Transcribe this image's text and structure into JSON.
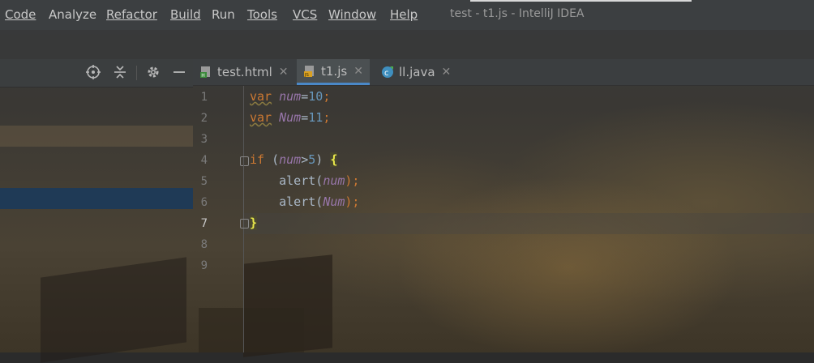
{
  "menu": {
    "items": [
      {
        "label": "Code",
        "mnemonic_index": 0
      },
      {
        "label": "Analyze",
        "mnemonic_index": -1
      },
      {
        "label": "Refactor",
        "mnemonic_index": 0
      },
      {
        "label": "Build",
        "mnemonic_index": 0
      },
      {
        "label": "Run",
        "mnemonic_index": 1
      },
      {
        "label": "Tools",
        "mnemonic_index": 0
      },
      {
        "label": "VCS",
        "mnemonic_index": 0
      },
      {
        "label": "Window",
        "mnemonic_index": 0
      },
      {
        "label": "Help",
        "mnemonic_index": 0
      }
    ],
    "window_title": "test - t1.js - IntelliJ IDEA"
  },
  "project_toolbar": {
    "icons": [
      "target-icon",
      "collapse-icon",
      "gear-icon",
      "minimize-icon"
    ]
  },
  "tabs": [
    {
      "label": "test.html",
      "icon": "html-file-icon",
      "active": false
    },
    {
      "label": "t1.js",
      "icon": "js-file-icon",
      "active": true
    },
    {
      "label": "ll.java",
      "icon": "java-class-icon",
      "active": false
    }
  ],
  "editor": {
    "line_numbers": [
      "1",
      "2",
      "3",
      "4",
      "5",
      "6",
      "7",
      "8",
      "9"
    ],
    "current_line": "7",
    "code_lines": [
      "var num=10;",
      "var Num=11;",
      "",
      "if (num>5) {",
      "    alert(num);",
      "    alert(Num);",
      "}",
      "",
      ""
    ]
  },
  "colors": {
    "keyword": "#cc7832",
    "variable": "#9876aa",
    "number": "#6897bb",
    "function": "#ffc66d",
    "text": "#a9b7c6",
    "active_tab_underline": "#4a88c7"
  }
}
